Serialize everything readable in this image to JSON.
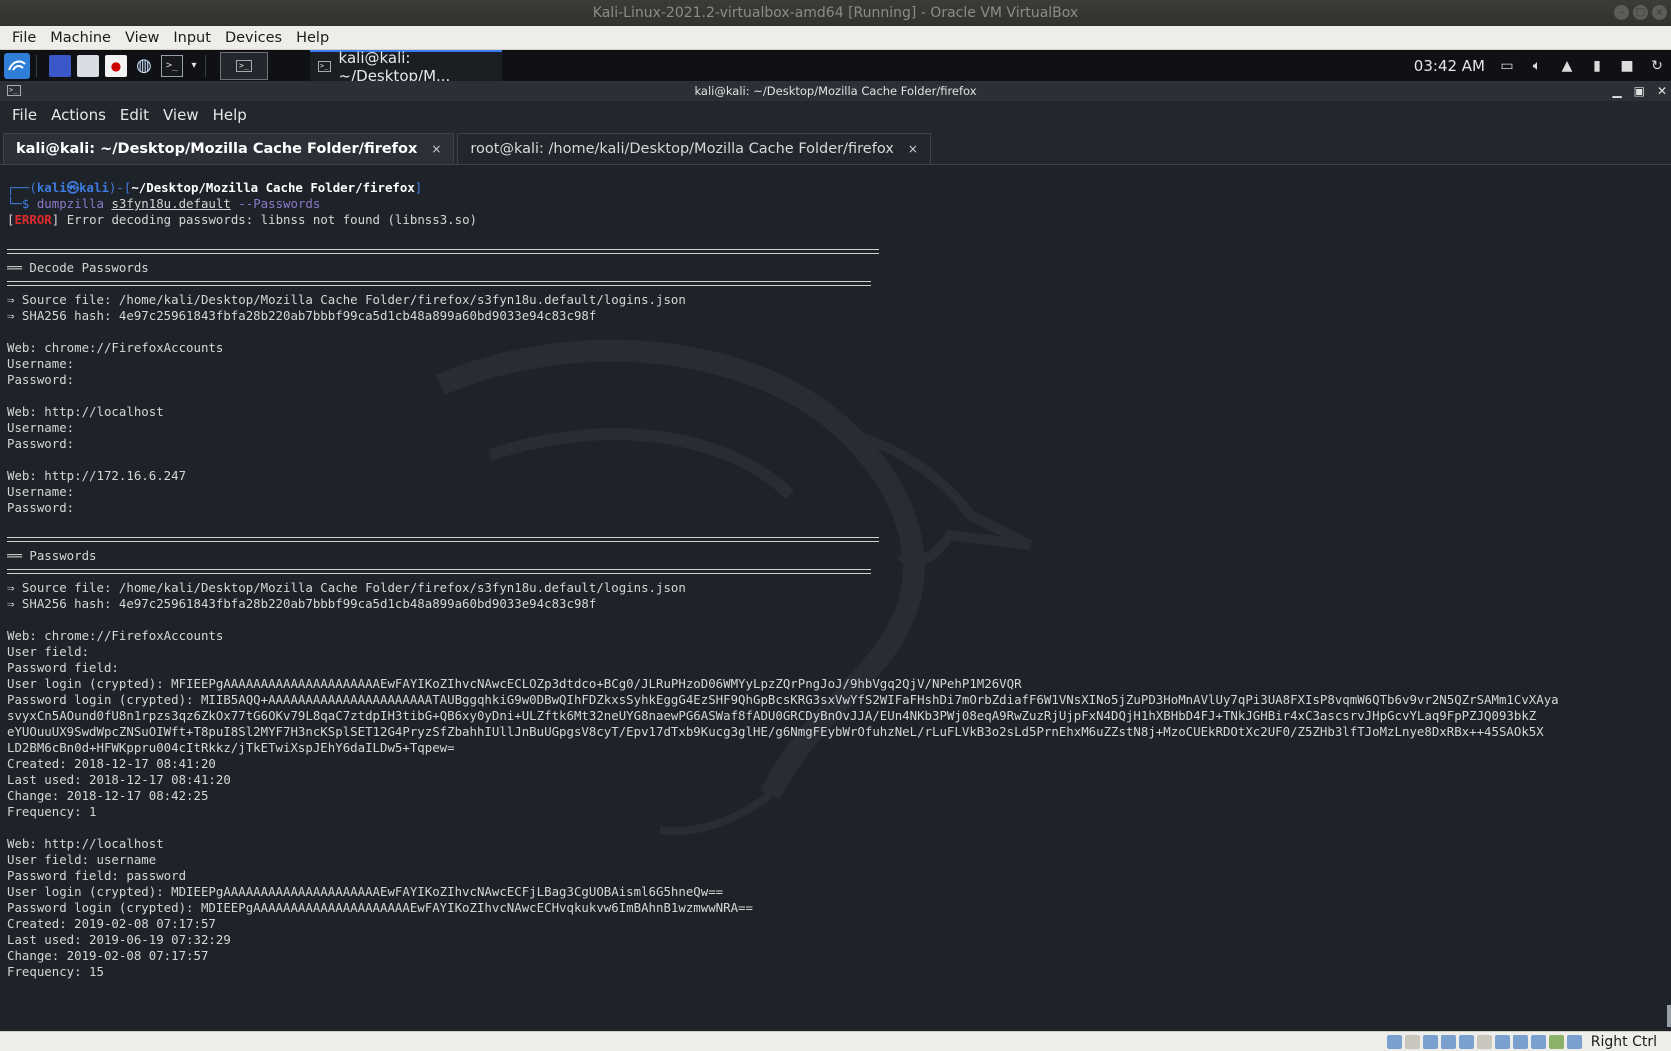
{
  "host_window": {
    "title": "Kali-Linux-2021.2-virtualbox-amd64 [Running] - Oracle VM VirtualBox"
  },
  "vbox_menu": [
    "File",
    "Machine",
    "View",
    "Input",
    "Devices",
    "Help"
  ],
  "kali_panel": {
    "task_label": "kali@kali: ~/Desktop/M...",
    "clock": "03:42 AM"
  },
  "terminal": {
    "title": "kali@kali: ~/Desktop/Mozilla Cache Folder/firefox",
    "menu": [
      "File",
      "Actions",
      "Edit",
      "View",
      "Help"
    ],
    "tabs": [
      {
        "label": "kali@kali: ~/Desktop/Mozilla Cache Folder/firefox",
        "close": "×"
      },
      {
        "label": "root@kali: /home/kali/Desktop/Mozilla Cache Folder/firefox",
        "close": "×"
      }
    ],
    "prompt": {
      "corner": "┌──(",
      "user": "kali",
      "at": "㉿",
      "host": "kali",
      "mid": ")-[",
      "path": "~/Desktop/Mozilla Cache Folder/firefox",
      "end": "]",
      "dollar_prefix": "└─$ ",
      "cmd": "dumpzilla",
      "arg": "s3fyn18u.default",
      "flag": "--Passwords"
    },
    "error": {
      "open": "[",
      "tag": "ERROR",
      "close": "] ",
      "message": "Error decoding passwords: libnss not found (libnss3.so)"
    },
    "section1": {
      "header": "══ Decode Passwords",
      "source": "⇒ Source file: /home/kali/Desktop/Mozilla Cache Folder/firefox/s3fyn18u.default/logins.json",
      "hash": "⇒ SHA256 hash: 4e97c25961843fbfa28b220ab7bbbf99ca5d1cb48a899a60bd9033e94c83c98f",
      "entries": [
        {
          "web": "Web: chrome://FirefoxAccounts",
          "user": "Username:",
          "pass": "Password:"
        },
        {
          "web": "Web: http://localhost",
          "user": "Username:",
          "pass": "Password:"
        },
        {
          "web": "Web: http://172.16.6.247",
          "user": "Username:",
          "pass": "Password:"
        }
      ]
    },
    "section2": {
      "header": "══ Passwords",
      "source": "⇒ Source file: /home/kali/Desktop/Mozilla Cache Folder/firefox/s3fyn18u.default/logins.json",
      "hash": "⇒ SHA256 hash: 4e97c25961843fbfa28b220ab7bbbf99ca5d1cb48a899a60bd9033e94c83c98f",
      "entry1": [
        "Web: chrome://FirefoxAccounts",
        "User field:",
        "Password field:",
        "User login (crypted): MFIEEPgAAAAAAAAAAAAAAAAAAAAAEwFAYIKoZIhvcNAwcECLOZp3dtdco+BCg0/JLRuPHzoD06WMYyLpzZQrPngJoJ/9hbVgq2QjV/NPehP1M26VQR",
        "Password login (crypted): MIIB5AQQ+AAAAAAAAAAAAAAAAAAAAAATAUBggqhkiG9w0DBwQIhFDZkxsSyhkEggG4EzSHF9QhGpBcsKRG3sxVwYfS2WIFaFHshDi7mOrbZdiafF6W1VNsXINo5jZuPD3HoMnAVlUy7qPi3UA8FXIsP8vqmW6QTb6v9vr2N5QZrSAMm1CvXAya",
        "svyxCn5AOund0fU8n1rpzs3qz6ZkOx77tG6OKv79L8qaC7ztdpIH3tibG+QB6xy0yDni+ULZftk6Mt32neUYG8naewPG6ASWaf8fADU0GRCDyBnOvJJA/EUn4NKb3PWj08eqA9RwZuzRjUjpFxN4DQjH1hXBHbD4FJ+TNkJGHBir4xC3ascsrvJHpGcvYLaq9FpPZJQ093bkZ",
        "eYUOuuUX9SwdWpcZNSuOIWft+T8puI8Sl2MYF7H3ncKSplSET12G4PryzSfZbahhIUllJnBuUGpgsV8cyT/Epv17dTxb9Kucg3glHE/g6NmgFEybWrOfuhzNeL/rLuFLVkB3o2sLd5PrnEhxM6uZZstN8j+MzoCUEkRDOtXc2UF0/Z5ZHb3lfTJoMzLnye8DxRBx++45SAOk5X",
        "LD2BM6cBn0d+HFWKppru004cItRkkz/jTkETwiXspJEhY6daILDw5+Tqpew=",
        "Created: 2018-12-17 08:41:20",
        "Last used: 2018-12-17 08:41:20",
        "Change: 2018-12-17 08:42:25",
        "Frequency: 1"
      ],
      "entry2": [
        "Web: http://localhost",
        "User field: username",
        "Password field: password",
        "User login (crypted): MDIEEPgAAAAAAAAAAAAAAAAAAAAAEwFAYIKoZIhvcNAwcECFjLBag3CgUOBAisml6G5hneQw==",
        "Password login (crypted): MDIEEPgAAAAAAAAAAAAAAAAAAAAAEwFAYIKoZIhvcNAwcECHvqkukvw6ImBAhnB1wzmwwNRA==",
        "Created: 2019-02-08 07:17:57",
        "Last used: 2019-06-19 07:32:29",
        "Change: 2019-02-08 07:17:57",
        "Frequency: 15"
      ]
    }
  },
  "vbox_status": {
    "host_key": "Right Ctrl"
  }
}
